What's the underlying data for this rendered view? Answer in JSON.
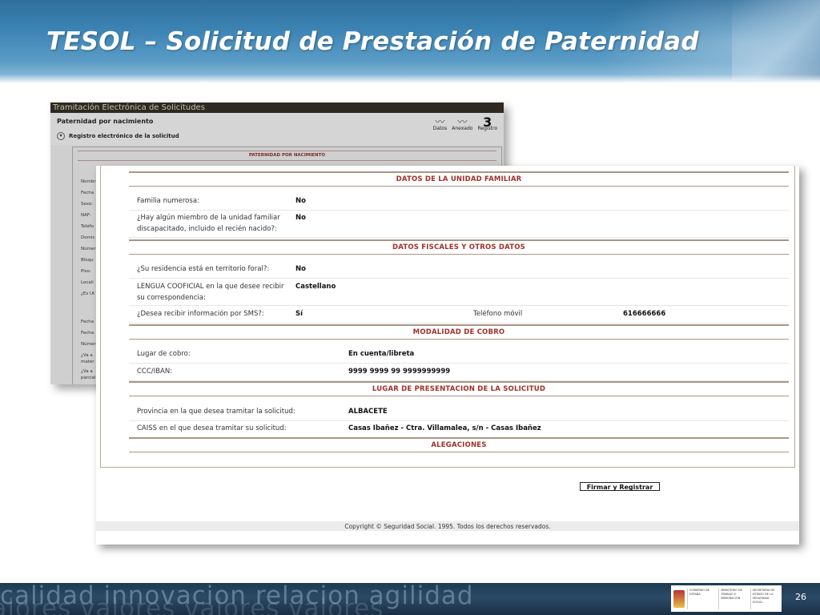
{
  "slide": {
    "title": "TESOL – Solicitud de Prestación de Paternidad",
    "page_number": "26",
    "bottom_words": "calidad   innovacion   relacion   agilidad",
    "bottom_words_2": "valores   valores   valores   valores"
  },
  "back_window": {
    "titlebar": "Tramitación Electrónica de Solicitudes",
    "heading": "Paternidad por nacimiento",
    "subheading": "Registro electrónico de la solicitud",
    "icons": [
      {
        "name": "datos-icon",
        "label": "Datos"
      },
      {
        "name": "anexado-icon",
        "label": "Anexado"
      },
      {
        "name": "registro-icon",
        "label": "Registro"
      }
    ],
    "section_title": "PATERNIDAD POR NACIMIENTO",
    "labels": [
      "Nombr",
      "Fecha",
      "Sexo:",
      "NAF:",
      "Teléfo",
      "Domic",
      "Númer",
      "Bloqu",
      "Piso:",
      "Locali",
      "¿Es Ut",
      "Fecha",
      "Fecha",
      "Númer",
      "¿Va a",
      "mater",
      "¿Va a",
      "parcial"
    ]
  },
  "form": {
    "sections": {
      "familiar": "DATOS DE LA UNIDAD FAMILIAR",
      "fiscales": "DATOS FISCALES Y OTROS DATOS",
      "cobro": "MODALIDAD DE COBRO",
      "lugar": "LUGAR DE PRESENTACION DE LA SOLICITUD",
      "alegaciones": "ALEGACIONES"
    },
    "familiar": {
      "numerosa_label": "Familia numerosa:",
      "numerosa_value": "No",
      "discapacitado_label_1": "¿Hay algún miembro de la unidad familiar",
      "discapacitado_label_2": "discapacitado, incluido el recién nacido?:",
      "discapacitado_value": "No"
    },
    "fiscales": {
      "foral_label": "¿Su residencia está en territorio foral?:",
      "foral_value": "No",
      "lengua_label_1": "LENGUA COOFICIAL en la que desee recibir",
      "lengua_label_2": "su correspondencia:",
      "lengua_value": "Castellano",
      "sms_label": "¿Desea recibir información por SMS?:",
      "sms_value": "Sí",
      "movil_label": "Teléfono móvil",
      "movil_value": "616666666"
    },
    "cobro": {
      "lugar_label": "Lugar de cobro:",
      "lugar_value": "En cuenta/libreta",
      "iban_label": "CCC/IBAN:",
      "iban_value": "9999 9999 99 9999999999"
    },
    "lugar": {
      "provincia_label": "Provincia en la que desea tramitar la solicitud:",
      "provincia_value": "ALBACETE",
      "caiss_label": "CAISS en el que desea tramitar su solicitud:",
      "caiss_value": "Casas Ibañez - Ctra. Villamalea, s/n - Casas Ibañez"
    },
    "submit_label": "Firmar y Registrar",
    "copyright": "Copyright © Seguridad Social. 1995. Todos los derechos reservados."
  },
  "logos": {
    "gobierno": "GOBIERNO DE ESPAÑA",
    "ministerio": "MINISTERIO DE TRABAJO E INMIGRACIÓN",
    "secretaria": "SECRETARÍA DE ESTADO DE LA SEGURIDAD SOCIAL"
  }
}
